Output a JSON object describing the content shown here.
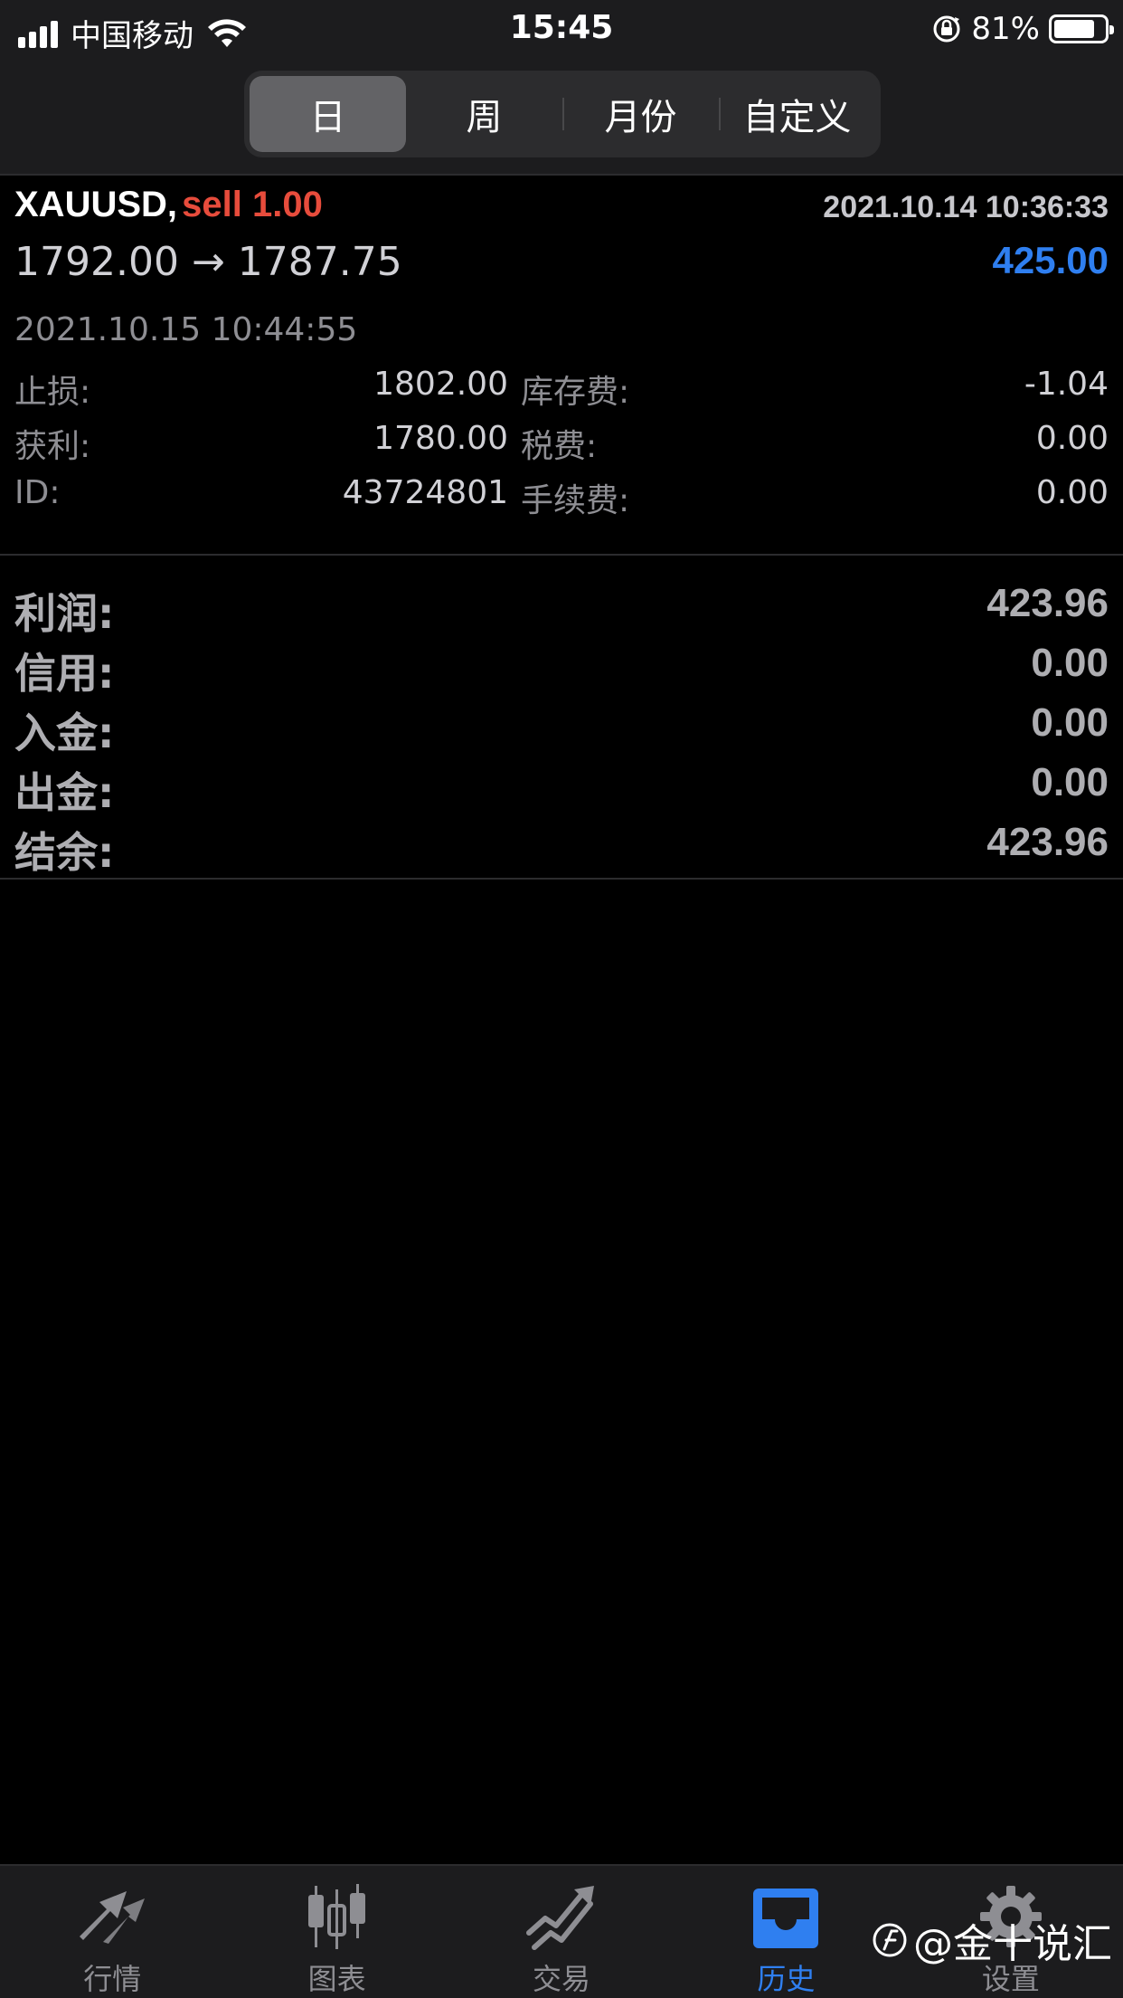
{
  "status_bar": {
    "carrier": "中国移动",
    "time": "15:45",
    "battery": "81%",
    "battery_level": 0.81
  },
  "tabs_period": [
    {
      "label": "日",
      "active": true
    },
    {
      "label": "周",
      "active": false
    },
    {
      "label": "月份",
      "active": false
    },
    {
      "label": "自定义",
      "active": false
    }
  ],
  "trade": {
    "symbol": "XAUUSD,",
    "side": "sell 1.00",
    "open_time": "2021.10.14 10:36:33",
    "prices": "1792.00 → 1787.75",
    "profit": "425.00",
    "close_time": "2021.10.15 10:44:55",
    "details": [
      {
        "label_left": "止损:",
        "value_left": "1802.00",
        "label_right": "库存费:",
        "value_right": "-1.04"
      },
      {
        "label_left": "获利:",
        "value_left": "1780.00",
        "label_right": "税费:",
        "value_right": "0.00"
      },
      {
        "label_left": "ID:",
        "value_left": "43724801",
        "label_right": "手续费:",
        "value_right": "0.00"
      }
    ]
  },
  "summary": [
    {
      "label": "利润:",
      "value": "423.96"
    },
    {
      "label": "信用:",
      "value": "0.00"
    },
    {
      "label": "入金:",
      "value": "0.00"
    },
    {
      "label": "出金:",
      "value": "0.00"
    },
    {
      "label": "结余:",
      "value": "423.96"
    }
  ],
  "tab_bar": [
    {
      "label": "行情",
      "icon": "quotes-arrows-icon",
      "active": false
    },
    {
      "label": "图表",
      "icon": "candlestick-chart-icon",
      "active": false
    },
    {
      "label": "交易",
      "icon": "trade-trend-icon",
      "active": false
    },
    {
      "label": "历史",
      "icon": "history-inbox-icon",
      "active": true
    },
    {
      "label": "设置",
      "icon": "gear-icon",
      "active": false
    }
  ],
  "watermark": "@金十说汇",
  "colors": {
    "accent_blue": "#2f7ff0",
    "sell_red": "#e74c3c",
    "background": "#000000",
    "bar_background": "#1c1c1e"
  }
}
